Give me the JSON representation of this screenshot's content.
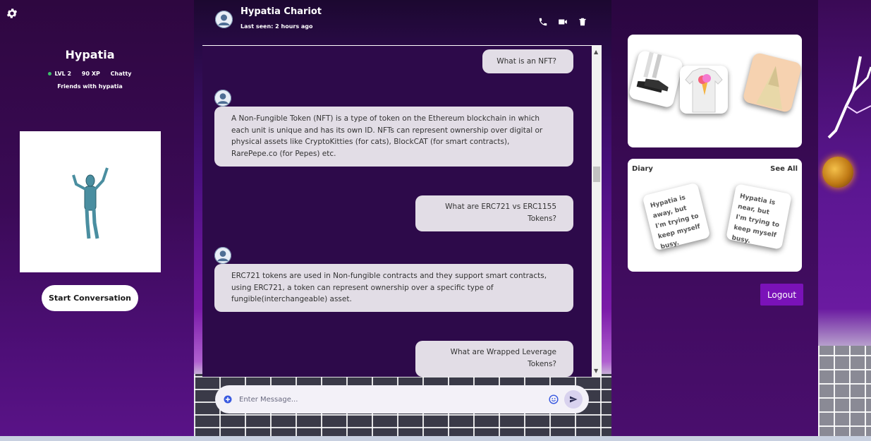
{
  "profile": {
    "name": "Hypatia",
    "level": "LVL 2",
    "xp": "90 XP",
    "mood": "Chatty",
    "friends_text": "Friends with hypatia",
    "start_button": "Start Conversation"
  },
  "chat": {
    "contact_name": "Hypatia Chariot",
    "last_seen": "Last seen: 2 hours ago",
    "messages": [
      {
        "from": "user",
        "text": "What is an NFT?"
      },
      {
        "from": "bot",
        "text": "A Non-Fungible Token (NFT) is a type of token on the Ethereum blockchain in which each unit is unique and has its own ID. NFTs can represent ownership over digital or physical assets like CryptoKitties (for cats), BlockCAT (for smart contracts), RarePepe.co (for Pepes) etc."
      },
      {
        "from": "user",
        "text": "What are ERC721 vs ERC1155 Tokens?"
      },
      {
        "from": "bot",
        "text": "ERC721 tokens are used in Non-fungible contracts and they support smart contracts, using ERC721, a token can represent ownership over a specific type of fungible(interchangeable) asset."
      },
      {
        "from": "user",
        "text": "What are Wrapped Leverage Tokens?"
      }
    ],
    "input_placeholder": "Enter Message..."
  },
  "diary": {
    "title": "Diary",
    "see_all": "See All",
    "notes": [
      "Hypatia is away, but I'm trying to keep myself busy.",
      "Hypatia is near, but I'm trying to keep myself busy."
    ]
  },
  "logout_label": "Logout",
  "colors": {
    "accent": "#7a12b8",
    "bubble": "#e2dde6",
    "panel_dark": "#3a0a55"
  },
  "icons": {
    "settings": "gear-icon",
    "call": "phone-icon",
    "video": "video-icon",
    "delete": "trash-icon",
    "attach": "plus-circle-icon",
    "emoji": "smile-icon",
    "send": "send-icon"
  }
}
